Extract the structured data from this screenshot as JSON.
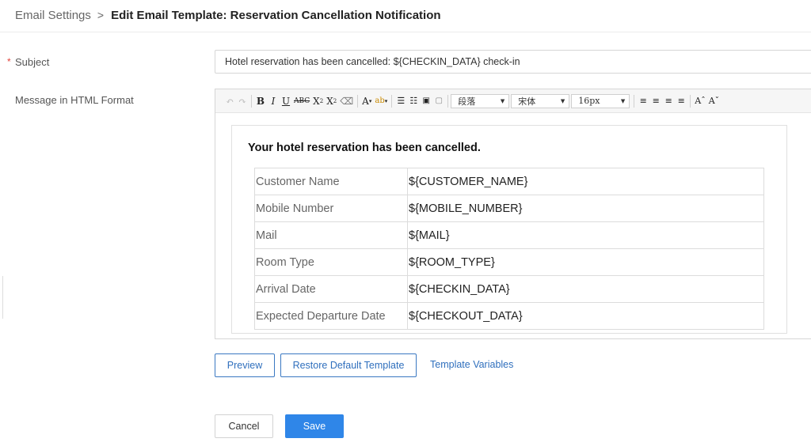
{
  "breadcrumb": {
    "parent": "Email Settings",
    "separator": ">",
    "current": "Edit Email Template: Reservation Cancellation Notification"
  },
  "form": {
    "subject_label": "Subject",
    "required_mark": "*",
    "subject_value": "Hotel reservation has been cancelled: ${CHECKIN_DATA} check-in",
    "message_label": "Message in HTML Format"
  },
  "toolbar": {
    "paragraph_select": "段落",
    "font_select": "宋体",
    "size_select": "16px",
    "icons": [
      "undo-icon",
      "redo-icon",
      "bold-icon",
      "italic-icon",
      "underline-icon",
      "strikethrough-icon",
      "superscript-icon",
      "subscript-icon",
      "eraser-icon",
      "font-color-icon",
      "highlight-icon",
      "ordered-list-icon",
      "unordered-list-icon",
      "insert-code-icon",
      "paste-text-icon",
      "align-left-icon",
      "align-center-icon",
      "align-justify-icon",
      "align-right-icon",
      "font-grow-icon",
      "font-shrink-icon"
    ]
  },
  "email": {
    "heading": "Your hotel reservation has been cancelled.",
    "rows": [
      {
        "key": "Customer Name",
        "value": "${CUSTOMER_NAME}"
      },
      {
        "key": "Mobile Number",
        "value": "${MOBILE_NUMBER}"
      },
      {
        "key": "Mail",
        "value": "${MAIL}"
      },
      {
        "key": "Room Type",
        "value": "${ROOM_TYPE}"
      },
      {
        "key": "Arrival Date",
        "value": "${CHECKIN_DATA}"
      },
      {
        "key": "Expected Departure Date",
        "value": "${CHECKOUT_DATA}"
      }
    ]
  },
  "actions": {
    "preview": "Preview",
    "restore": "Restore Default Template",
    "variables": "Template Variables",
    "cancel": "Cancel",
    "save": "Save"
  },
  "colors": {
    "accent": "#2f86e8",
    "link": "#2f6fbd",
    "required": "#e2443b"
  }
}
